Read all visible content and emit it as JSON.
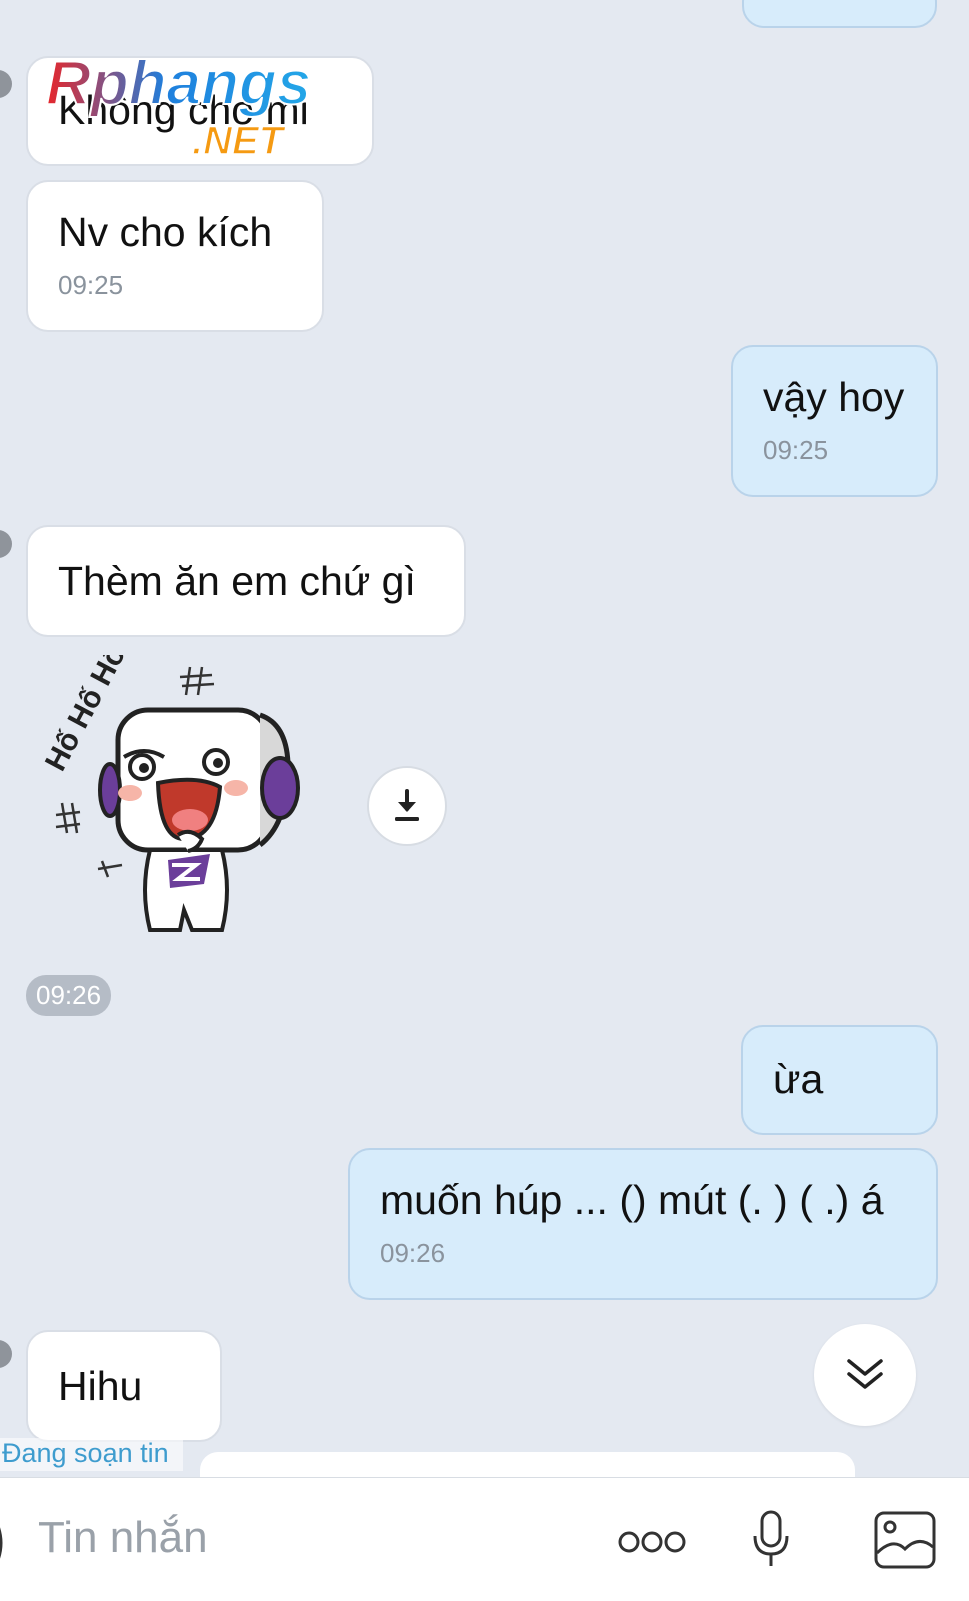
{
  "messages": [
    {
      "direction": "incoming",
      "text": "Không cho mi"
    },
    {
      "direction": "incoming",
      "text": "Nv cho kích",
      "time": "09:25"
    },
    {
      "direction": "outgoing",
      "text": "vậy hoy",
      "time": "09:25"
    },
    {
      "direction": "incoming",
      "text": "Thèm ăn em chứ gì"
    },
    {
      "direction": "incoming",
      "type": "sticker",
      "sticker_text": "Hố Hố Hố",
      "time": "09:26"
    },
    {
      "direction": "outgoing",
      "text": "ừa"
    },
    {
      "direction": "outgoing",
      "text": "muốn húp ... () mút (. ) ( .) á",
      "time": "09:26"
    },
    {
      "direction": "incoming",
      "text": "Hihu"
    }
  ],
  "watermark": {
    "line1": "Rphangs",
    "line2": ".NET"
  },
  "typing_indicator": "Đang soạn tin",
  "composer": {
    "placeholder": "Tin nhắn"
  },
  "icons": {
    "download": "download-icon",
    "scroll_down": "chevron-double-down-icon",
    "more": "more-dots-icon",
    "mic": "microphone-icon",
    "image": "image-icon"
  },
  "colors": {
    "background": "#e4e9f1",
    "incoming_bubble": "#ffffff",
    "outgoing_bubble": "#d7ecfb",
    "typing_text": "#3e9cce"
  }
}
